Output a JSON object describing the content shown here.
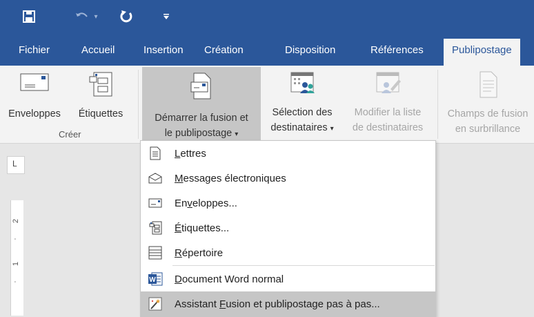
{
  "quick_access": {
    "save_icon": "save-icon",
    "undo_icon": "undo-icon",
    "redo_icon": "redo-icon",
    "customize_icon": "customize-qat-icon"
  },
  "tabs": [
    "Fichier",
    "Accueil",
    "Insertion",
    "Création",
    "Disposition",
    "Références",
    "Publipostage"
  ],
  "active_tab": "Publipostage",
  "ribbon": {
    "enveloppes": "Enveloppes",
    "etiquettes": "Étiquettes",
    "group_creer": "Créer",
    "demarrer_line1": "Démarrer la fusion et",
    "demarrer_line2": "le publipostage",
    "selection_line1": "Sélection des",
    "selection_line2": "destinataires",
    "modifier_line1": "Modifier la liste",
    "modifier_line2": "de destinataires",
    "champs_line1": "Champs de fusion",
    "champs_line2": "en surbrillance",
    "dropdown_arrow": "▾"
  },
  "ruler": {
    "corner": "L",
    "marks": [
      "2",
      "·",
      "1",
      "·"
    ]
  },
  "menu": {
    "items": [
      {
        "pre": "",
        "u": "L",
        "post": "ettres"
      },
      {
        "pre": "",
        "u": "M",
        "post": "essages électroniques"
      },
      {
        "pre": "En",
        "u": "v",
        "post": "eloppes..."
      },
      {
        "pre": "",
        "u": "É",
        "post": "tiquettes..."
      },
      {
        "pre": "",
        "u": "R",
        "post": "épertoire"
      },
      {
        "pre": "",
        "u": "D",
        "post": "ocument Word normal"
      },
      {
        "pre": "Assistant ",
        "u": "F",
        "post": "usion et publipostage pas à pas..."
      }
    ]
  },
  "colors": {
    "brand": "#2b579a",
    "ribbon_bg": "#f3f3f3",
    "hover": "#c6c6c6"
  }
}
